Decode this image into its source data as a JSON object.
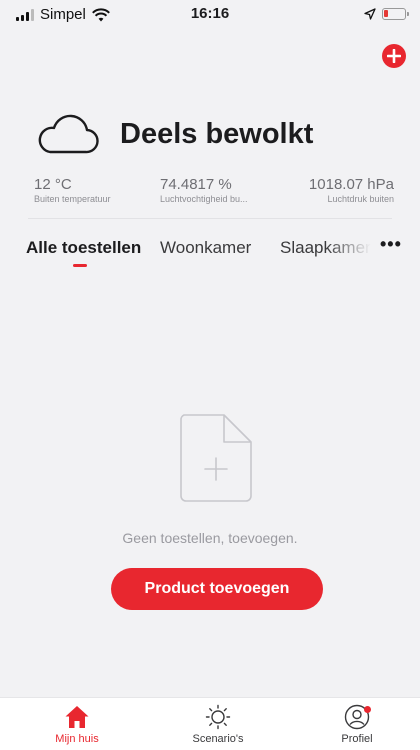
{
  "status_bar": {
    "carrier": "Simpel",
    "time": "16:16"
  },
  "weather": {
    "icon": "cloud-icon",
    "condition": "Deels bewolkt",
    "stats": [
      {
        "value": "12 °C",
        "label": "Buiten temperatuur"
      },
      {
        "value": "74.4817 %",
        "label": "Luchtvochtigheid bu..."
      },
      {
        "value": "1018.07 hPa",
        "label": "Luchtdruk buiten"
      }
    ]
  },
  "tabs": [
    {
      "label": "Alle toestellen",
      "active": true
    },
    {
      "label": "Woonkamer",
      "active": false
    },
    {
      "label": "Slaapkamer",
      "active": false
    }
  ],
  "tabs_more": "•••",
  "empty_state": {
    "message": "Geen toestellen, toevoegen.",
    "button": "Product toevoegen"
  },
  "bottom_nav": [
    {
      "label": "Mijn huis",
      "icon": "home-icon",
      "active": true
    },
    {
      "label": "Scenario's",
      "icon": "sun-icon",
      "active": false
    },
    {
      "label": "Profiel",
      "icon": "profile-icon",
      "active": false
    }
  ],
  "colors": {
    "accent": "#e8272f",
    "background": "#f2f2f4"
  }
}
